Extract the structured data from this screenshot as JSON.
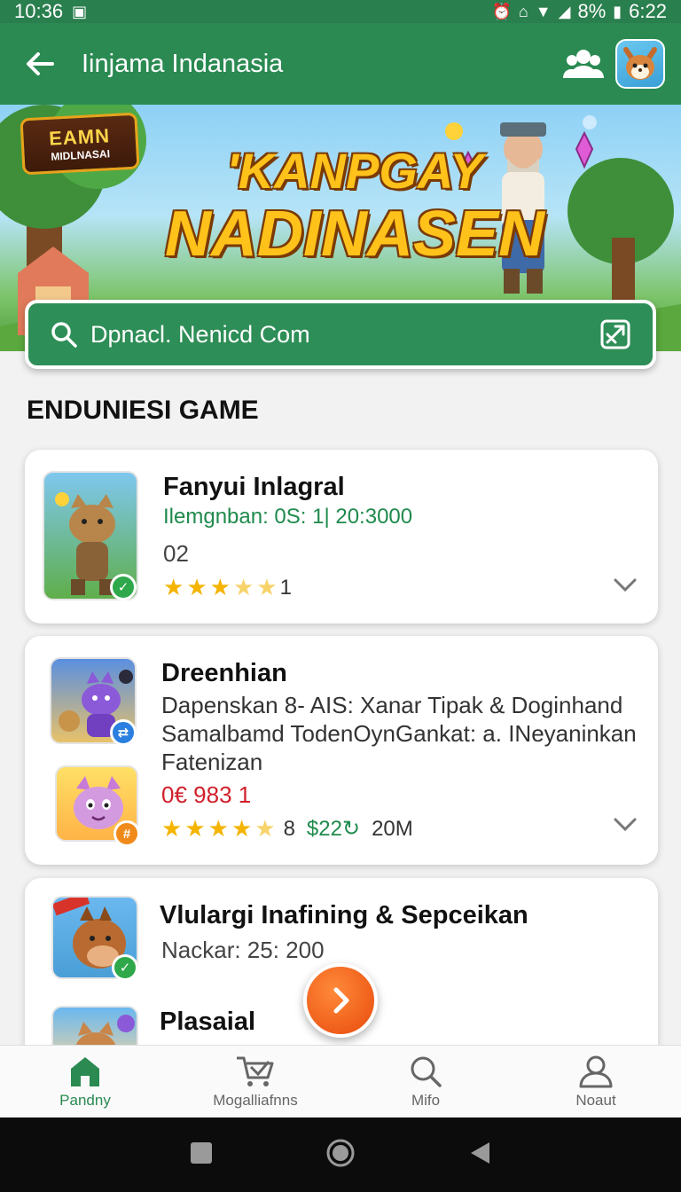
{
  "status_bar": {
    "time_left": "10:36",
    "battery": "8%",
    "time_right": "6:22"
  },
  "app_bar": {
    "title": "Iinjama Indanasia"
  },
  "banner": {
    "logo_line1": "EAMN",
    "logo_line2": "MIDLNASAI",
    "title_line1": "'KANPGAY",
    "title_line2": "NADINASEN"
  },
  "search": {
    "placeholder": "Dpnacl. Nenicd Com"
  },
  "section": {
    "title": "ENDUNIESI GAME"
  },
  "games": [
    {
      "name": "Fanyui Inlagral",
      "meta": "Ilemgnban: 0S: 1| 20:3000",
      "sub": "02",
      "rating_count": "1"
    },
    {
      "name": "Dreenhian",
      "description": [
        "Dapenskan 8- AIS: Xanar Tipak & Doginhand",
        "Samalbamd TodenOynGankat: a. INeyaninkan",
        "Fatenizan"
      ],
      "price": "0€ 983 1",
      "rating_count": "8",
      "price_green": "$22↻",
      "size": "20M"
    },
    {
      "name": "Vlulargi Inafining & Sepceikan",
      "meta": "Nackar: 25: 200",
      "name2": "Plasaial"
    }
  ],
  "bottom_nav": [
    {
      "label": "Pandny",
      "icon": "home-icon",
      "active": true
    },
    {
      "label": "Mogalliafnns",
      "icon": "cart-icon",
      "active": false
    },
    {
      "label": "Mifo",
      "icon": "search-icon",
      "active": false
    },
    {
      "label": "Noaut",
      "icon": "profile-icon",
      "active": false
    }
  ],
  "colors": {
    "primary": "#2a8a52",
    "accent": "#e84a0c",
    "star": "#f4b400",
    "price_red": "#d0202a"
  }
}
